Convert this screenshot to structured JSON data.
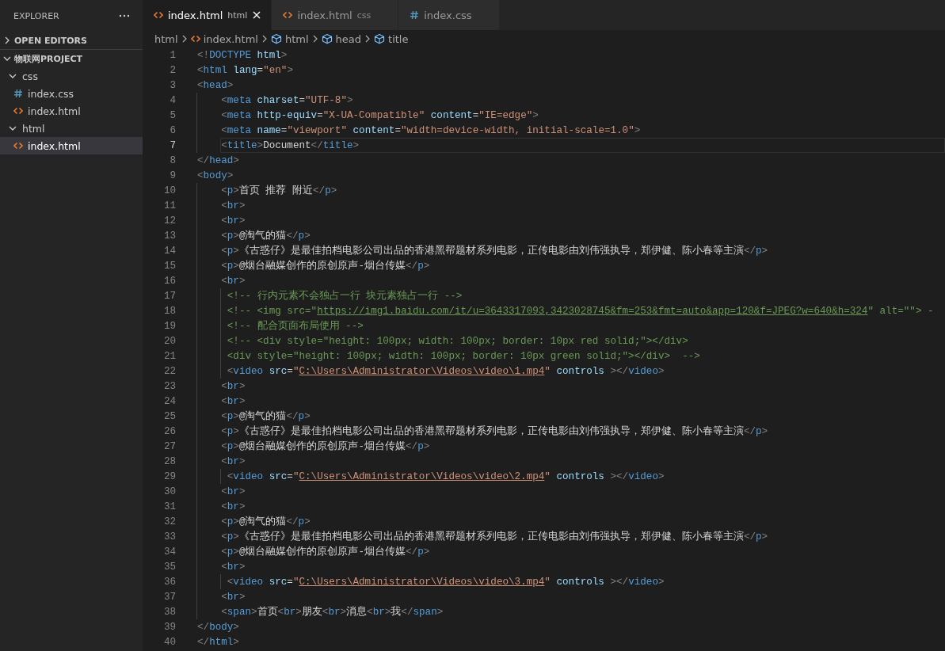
{
  "sidebar": {
    "title": "EXPLORER",
    "sections": [
      {
        "label": "OPEN EDITORS",
        "expanded": false
      },
      {
        "label": "物联网PROJECT",
        "expanded": true,
        "children": [
          {
            "label": "css",
            "kind": "folder",
            "expanded": true,
            "selected": false,
            "children": [
              {
                "label": "index.css",
                "kind": "css",
                "selected": false
              },
              {
                "label": "index.html",
                "kind": "html",
                "selected": false
              }
            ]
          },
          {
            "label": "html",
            "kind": "folder",
            "expanded": true,
            "selected": false,
            "children": [
              {
                "label": "index.html",
                "kind": "html",
                "selected": true
              }
            ]
          }
        ]
      }
    ]
  },
  "tabs": [
    {
      "label": "index.html",
      "description": "html",
      "kind": "html",
      "selected": true
    },
    {
      "label": "index.html",
      "description": "css",
      "kind": "html",
      "selected": false
    },
    {
      "label": "index.css",
      "kind": "css",
      "selected": false
    }
  ],
  "breadcrumbs": [
    {
      "label": "html",
      "kind": "folder"
    },
    {
      "label": "index.html",
      "kind": "html"
    },
    {
      "label": "html",
      "kind": "symbol"
    },
    {
      "label": "head",
      "kind": "symbol"
    },
    {
      "label": "title",
      "kind": "symbol"
    }
  ],
  "code": [
    {
      "number": "1",
      "kind": "top",
      "active": false,
      "tokens": [
        {
          "kind": "punct",
          "text": "<!"
        },
        {
          "kind": "tag",
          "text": "DOCTYPE"
        },
        {
          "kind": "attr",
          "text": " html"
        },
        {
          "kind": "punct",
          "text": ">"
        }
      ]
    },
    {
      "number": "2",
      "kind": "top",
      "active": false,
      "tokens": [
        {
          "kind": "punct",
          "text": "<"
        },
        {
          "kind": "tag",
          "text": "html"
        },
        {
          "kind": "attr",
          "text": " lang"
        },
        {
          "kind": "eq",
          "text": "="
        },
        {
          "kind": "str",
          "text": "\"en\""
        },
        {
          "kind": "punct",
          "text": ">"
        }
      ]
    },
    {
      "number": "3",
      "kind": "top",
      "active": false,
      "tokens": [
        {
          "kind": "punct",
          "text": "<"
        },
        {
          "kind": "tag",
          "text": "head"
        },
        {
          "kind": "punct",
          "text": ">"
        }
      ]
    },
    {
      "number": "4",
      "kind": "nested",
      "active": false,
      "tokens": [
        {
          "kind": "punct",
          "text": "<"
        },
        {
          "kind": "tag",
          "text": "meta"
        },
        {
          "kind": "attr",
          "text": " charset"
        },
        {
          "kind": "eq",
          "text": "="
        },
        {
          "kind": "str",
          "text": "\"UTF-8\""
        },
        {
          "kind": "punct",
          "text": ">"
        }
      ]
    },
    {
      "number": "5",
      "kind": "nested",
      "active": false,
      "tokens": [
        {
          "kind": "punct",
          "text": "<"
        },
        {
          "kind": "tag",
          "text": "meta"
        },
        {
          "kind": "attr",
          "text": " http-equiv"
        },
        {
          "kind": "eq",
          "text": "="
        },
        {
          "kind": "str",
          "text": "\"X-UA-Compatible\""
        },
        {
          "kind": "attr",
          "text": " content"
        },
        {
          "kind": "eq",
          "text": "="
        },
        {
          "kind": "str",
          "text": "\"IE=edge\""
        },
        {
          "kind": "punct",
          "text": ">"
        }
      ]
    },
    {
      "number": "6",
      "kind": "nested",
      "active": false,
      "tokens": [
        {
          "kind": "punct",
          "text": "<"
        },
        {
          "kind": "tag",
          "text": "meta"
        },
        {
          "kind": "attr",
          "text": " name"
        },
        {
          "kind": "eq",
          "text": "="
        },
        {
          "kind": "str",
          "text": "\"viewport\""
        },
        {
          "kind": "attr",
          "text": " content"
        },
        {
          "kind": "eq",
          "text": "="
        },
        {
          "kind": "str",
          "text": "\"width=device-width, initial-scale=1.0\""
        },
        {
          "kind": "punct",
          "text": ">"
        }
      ]
    },
    {
      "number": "7",
      "kind": "nested",
      "active": true,
      "tokens": [
        {
          "kind": "punct",
          "text": "<"
        },
        {
          "kind": "tag",
          "text": "title"
        },
        {
          "kind": "punct",
          "text": ">"
        },
        {
          "kind": "text",
          "text": "Document"
        },
        {
          "kind": "punct",
          "text": "</"
        },
        {
          "kind": "tag",
          "text": "title"
        },
        {
          "kind": "punct",
          "text": ">"
        }
      ]
    },
    {
      "number": "8",
      "kind": "top",
      "active": false,
      "tokens": [
        {
          "kind": "punct",
          "text": "</"
        },
        {
          "kind": "tag",
          "text": "head"
        },
        {
          "kind": "punct",
          "text": ">"
        }
      ]
    },
    {
      "number": "9",
      "kind": "top",
      "active": false,
      "tokens": [
        {
          "kind": "punct",
          "text": "<"
        },
        {
          "kind": "tag",
          "text": "body"
        },
        {
          "kind": "punct",
          "text": ">"
        }
      ]
    },
    {
      "number": "10",
      "kind": "nested",
      "active": false,
      "tokens": [
        {
          "kind": "punct",
          "text": "<"
        },
        {
          "kind": "tag",
          "text": "p"
        },
        {
          "kind": "punct",
          "text": ">"
        },
        {
          "kind": "text",
          "text": "首页 推荐 附近"
        },
        {
          "kind": "punct",
          "text": "</"
        },
        {
          "kind": "tag",
          "text": "p"
        },
        {
          "kind": "punct",
          "text": ">"
        }
      ]
    },
    {
      "number": "11",
      "kind": "nested",
      "active": false,
      "tokens": [
        {
          "kind": "punct",
          "text": "<"
        },
        {
          "kind": "tag",
          "text": "br"
        },
        {
          "kind": "punct",
          "text": ">"
        }
      ]
    },
    {
      "number": "12",
      "kind": "nested",
      "active": false,
      "tokens": [
        {
          "kind": "punct",
          "text": "<"
        },
        {
          "kind": "tag",
          "text": "br"
        },
        {
          "kind": "punct",
          "text": ">"
        }
      ]
    },
    {
      "number": "13",
      "kind": "nested",
      "active": false,
      "tokens": [
        {
          "kind": "punct",
          "text": "<"
        },
        {
          "kind": "tag",
          "text": "p"
        },
        {
          "kind": "punct",
          "text": ">"
        },
        {
          "kind": "text",
          "text": "@淘气的猫"
        },
        {
          "kind": "punct",
          "text": "</"
        },
        {
          "kind": "tag",
          "text": "p"
        },
        {
          "kind": "punct",
          "text": ">"
        }
      ]
    },
    {
      "number": "14",
      "kind": "nested",
      "active": false,
      "tokens": [
        {
          "kind": "punct",
          "text": "<"
        },
        {
          "kind": "tag",
          "text": "p"
        },
        {
          "kind": "punct",
          "text": ">"
        },
        {
          "kind": "text",
          "text": "《古惑仔》是最佳拍档电影公司出品的香港黑帮题材系列电影，正传电影由刘伟强执导，郑伊健、陈小春等主演"
        },
        {
          "kind": "punct",
          "text": "</"
        },
        {
          "kind": "tag",
          "text": "p"
        },
        {
          "kind": "punct",
          "text": ">"
        }
      ]
    },
    {
      "number": "15",
      "kind": "nested",
      "active": false,
      "tokens": [
        {
          "kind": "punct",
          "text": "<"
        },
        {
          "kind": "tag",
          "text": "p"
        },
        {
          "kind": "punct",
          "text": ">"
        },
        {
          "kind": "text",
          "text": "@烟台融媒创作的原创原声-烟台传媒"
        },
        {
          "kind": "punct",
          "text": "</"
        },
        {
          "kind": "tag",
          "text": "p"
        },
        {
          "kind": "punct",
          "text": ">"
        }
      ]
    },
    {
      "number": "16",
      "kind": "nested",
      "active": false,
      "tokens": [
        {
          "kind": "punct",
          "text": "<"
        },
        {
          "kind": "tag",
          "text": "br"
        },
        {
          "kind": "punct",
          "text": ">"
        }
      ]
    },
    {
      "number": "17",
      "kind": "nested_extra",
      "active": false,
      "tokens": [
        {
          "kind": "comment",
          "text": "<!-- 行内元素不会独占一行 块元素独占一行 -->"
        }
      ]
    },
    {
      "number": "18",
      "kind": "nested_extra",
      "active": false,
      "tokens": [
        {
          "kind": "comment",
          "text": "<!-- <img src=\""
        },
        {
          "kind": "clink",
          "text": "https://img1.baidu.com/it/u=3643317093,3423028745&fm=253&fmt=auto&app=120&f=JPEG?w=640&h=324"
        },
        {
          "kind": "comment",
          "text": "\" alt=\"\"> -"
        }
      ]
    },
    {
      "number": "19",
      "kind": "nested_extra",
      "active": false,
      "tokens": [
        {
          "kind": "comment",
          "text": "<!-- 配合页面布局使用 -->"
        }
      ]
    },
    {
      "number": "20",
      "kind": "nested_extra",
      "active": false,
      "tokens": [
        {
          "kind": "comment",
          "text": "<!-- <div style=\"height: 100px; width: 100px; border: 10px red solid;\"></div>"
        }
      ]
    },
    {
      "number": "21",
      "kind": "nested_extra",
      "active": false,
      "tokens": [
        {
          "kind": "comment",
          "text": "<div style=\"height: 100px; width: 100px; border: 10px green solid;\"></div>  -->"
        }
      ]
    },
    {
      "number": "22",
      "kind": "nested_extra",
      "active": false,
      "tokens": [
        {
          "kind": "punct",
          "text": "<"
        },
        {
          "kind": "tag",
          "text": "video"
        },
        {
          "kind": "attr",
          "text": " src"
        },
        {
          "kind": "eq",
          "text": "="
        },
        {
          "kind": "str",
          "text": "\""
        },
        {
          "kind": "link",
          "text": "C:\\Users\\Administrator\\Videos\\video\\1.mp4"
        },
        {
          "kind": "str",
          "text": "\""
        },
        {
          "kind": "attr",
          "text": " controls"
        },
        {
          "kind": "punct",
          "text": " ></"
        },
        {
          "kind": "tag",
          "text": "video"
        },
        {
          "kind": "punct",
          "text": ">"
        }
      ]
    },
    {
      "number": "23",
      "kind": "nested",
      "active": false,
      "tokens": [
        {
          "kind": "punct",
          "text": "<"
        },
        {
          "kind": "tag",
          "text": "br"
        },
        {
          "kind": "punct",
          "text": ">"
        }
      ]
    },
    {
      "number": "24",
      "kind": "nested",
      "active": false,
      "tokens": [
        {
          "kind": "punct",
          "text": "<"
        },
        {
          "kind": "tag",
          "text": "br"
        },
        {
          "kind": "punct",
          "text": ">"
        }
      ]
    },
    {
      "number": "25",
      "kind": "nested",
      "active": false,
      "tokens": [
        {
          "kind": "punct",
          "text": "<"
        },
        {
          "kind": "tag",
          "text": "p"
        },
        {
          "kind": "punct",
          "text": ">"
        },
        {
          "kind": "text",
          "text": "@淘气的猫"
        },
        {
          "kind": "punct",
          "text": "</"
        },
        {
          "kind": "tag",
          "text": "p"
        },
        {
          "kind": "punct",
          "text": ">"
        }
      ]
    },
    {
      "number": "26",
      "kind": "nested",
      "active": false,
      "tokens": [
        {
          "kind": "punct",
          "text": "<"
        },
        {
          "kind": "tag",
          "text": "p"
        },
        {
          "kind": "punct",
          "text": ">"
        },
        {
          "kind": "text",
          "text": "《古惑仔》是最佳拍档电影公司出品的香港黑帮题材系列电影，正传电影由刘伟强执导，郑伊健、陈小春等主演"
        },
        {
          "kind": "punct",
          "text": "</"
        },
        {
          "kind": "tag",
          "text": "p"
        },
        {
          "kind": "punct",
          "text": ">"
        }
      ]
    },
    {
      "number": "27",
      "kind": "nested",
      "active": false,
      "tokens": [
        {
          "kind": "punct",
          "text": "<"
        },
        {
          "kind": "tag",
          "text": "p"
        },
        {
          "kind": "punct",
          "text": ">"
        },
        {
          "kind": "text",
          "text": "@烟台融媒创作的原创原声-烟台传媒"
        },
        {
          "kind": "punct",
          "text": "</"
        },
        {
          "kind": "tag",
          "text": "p"
        },
        {
          "kind": "punct",
          "text": ">"
        }
      ]
    },
    {
      "number": "28",
      "kind": "nested",
      "active": false,
      "tokens": [
        {
          "kind": "punct",
          "text": "<"
        },
        {
          "kind": "tag",
          "text": "br"
        },
        {
          "kind": "punct",
          "text": ">"
        }
      ]
    },
    {
      "number": "29",
      "kind": "nested_extra",
      "active": false,
      "tokens": [
        {
          "kind": "punct",
          "text": "<"
        },
        {
          "kind": "tag",
          "text": "video"
        },
        {
          "kind": "attr",
          "text": " src"
        },
        {
          "kind": "eq",
          "text": "="
        },
        {
          "kind": "str",
          "text": "\""
        },
        {
          "kind": "link",
          "text": "C:\\Users\\Administrator\\Videos\\video\\2.mp4"
        },
        {
          "kind": "str",
          "text": "\""
        },
        {
          "kind": "attr",
          "text": " controls"
        },
        {
          "kind": "punct",
          "text": " ></"
        },
        {
          "kind": "tag",
          "text": "video"
        },
        {
          "kind": "punct",
          "text": ">"
        }
      ]
    },
    {
      "number": "30",
      "kind": "nested",
      "active": false,
      "tokens": [
        {
          "kind": "punct",
          "text": "<"
        },
        {
          "kind": "tag",
          "text": "br"
        },
        {
          "kind": "punct",
          "text": ">"
        }
      ]
    },
    {
      "number": "31",
      "kind": "nested",
      "active": false,
      "tokens": [
        {
          "kind": "punct",
          "text": "<"
        },
        {
          "kind": "tag",
          "text": "br"
        },
        {
          "kind": "punct",
          "text": ">"
        }
      ]
    },
    {
      "number": "32",
      "kind": "nested",
      "active": false,
      "tokens": [
        {
          "kind": "punct",
          "text": "<"
        },
        {
          "kind": "tag",
          "text": "p"
        },
        {
          "kind": "punct",
          "text": ">"
        },
        {
          "kind": "text",
          "text": "@淘气的猫"
        },
        {
          "kind": "punct",
          "text": "</"
        },
        {
          "kind": "tag",
          "text": "p"
        },
        {
          "kind": "punct",
          "text": ">"
        }
      ]
    },
    {
      "number": "33",
      "kind": "nested",
      "active": false,
      "tokens": [
        {
          "kind": "punct",
          "text": "<"
        },
        {
          "kind": "tag",
          "text": "p"
        },
        {
          "kind": "punct",
          "text": ">"
        },
        {
          "kind": "text",
          "text": "《古惑仔》是最佳拍档电影公司出品的香港黑帮题材系列电影，正传电影由刘伟强执导，郑伊健、陈小春等主演"
        },
        {
          "kind": "punct",
          "text": "</"
        },
        {
          "kind": "tag",
          "text": "p"
        },
        {
          "kind": "punct",
          "text": ">"
        }
      ]
    },
    {
      "number": "34",
      "kind": "nested",
      "active": false,
      "tokens": [
        {
          "kind": "punct",
          "text": "<"
        },
        {
          "kind": "tag",
          "text": "p"
        },
        {
          "kind": "punct",
          "text": ">"
        },
        {
          "kind": "text",
          "text": "@烟台融媒创作的原创原声-烟台传媒"
        },
        {
          "kind": "punct",
          "text": "</"
        },
        {
          "kind": "tag",
          "text": "p"
        },
        {
          "kind": "punct",
          "text": ">"
        }
      ]
    },
    {
      "number": "35",
      "kind": "nested",
      "active": false,
      "tokens": [
        {
          "kind": "punct",
          "text": "<"
        },
        {
          "kind": "tag",
          "text": "br"
        },
        {
          "kind": "punct",
          "text": ">"
        }
      ]
    },
    {
      "number": "36",
      "kind": "nested_extra",
      "active": false,
      "tokens": [
        {
          "kind": "punct",
          "text": "<"
        },
        {
          "kind": "tag",
          "text": "video"
        },
        {
          "kind": "attr",
          "text": " src"
        },
        {
          "kind": "eq",
          "text": "="
        },
        {
          "kind": "str",
          "text": "\""
        },
        {
          "kind": "link",
          "text": "C:\\Users\\Administrator\\Videos\\video\\3.mp4"
        },
        {
          "kind": "str",
          "text": "\""
        },
        {
          "kind": "attr",
          "text": " controls"
        },
        {
          "kind": "punct",
          "text": " ></"
        },
        {
          "kind": "tag",
          "text": "video"
        },
        {
          "kind": "punct",
          "text": ">"
        }
      ]
    },
    {
      "number": "37",
      "kind": "nested",
      "active": false,
      "tokens": [
        {
          "kind": "punct",
          "text": "<"
        },
        {
          "kind": "tag",
          "text": "br"
        },
        {
          "kind": "punct",
          "text": ">"
        }
      ]
    },
    {
      "number": "38",
      "kind": "nested",
      "active": false,
      "tokens": [
        {
          "kind": "punct",
          "text": "<"
        },
        {
          "kind": "tag",
          "text": "span"
        },
        {
          "kind": "punct",
          "text": ">"
        },
        {
          "kind": "text",
          "text": "首页"
        },
        {
          "kind": "punct",
          "text": "<"
        },
        {
          "kind": "tag",
          "text": "br"
        },
        {
          "kind": "punct",
          "text": ">"
        },
        {
          "kind": "text",
          "text": "朋友"
        },
        {
          "kind": "punct",
          "text": "<"
        },
        {
          "kind": "tag",
          "text": "br"
        },
        {
          "kind": "punct",
          "text": ">"
        },
        {
          "kind": "text",
          "text": "消息"
        },
        {
          "kind": "punct",
          "text": "<"
        },
        {
          "kind": "tag",
          "text": "br"
        },
        {
          "kind": "punct",
          "text": ">"
        },
        {
          "kind": "text",
          "text": "我"
        },
        {
          "kind": "punct",
          "text": "</"
        },
        {
          "kind": "tag",
          "text": "span"
        },
        {
          "kind": "punct",
          "text": ">"
        }
      ]
    },
    {
      "number": "39",
      "kind": "top",
      "active": false,
      "tokens": [
        {
          "kind": "punct",
          "text": "</"
        },
        {
          "kind": "tag",
          "text": "body"
        },
        {
          "kind": "punct",
          "text": ">"
        }
      ]
    },
    {
      "number": "40",
      "kind": "top",
      "active": false,
      "tokens": [
        {
          "kind": "punct",
          "text": "</"
        },
        {
          "kind": "tag",
          "text": "html"
        },
        {
          "kind": "punct",
          "text": ">"
        }
      ]
    }
  ]
}
